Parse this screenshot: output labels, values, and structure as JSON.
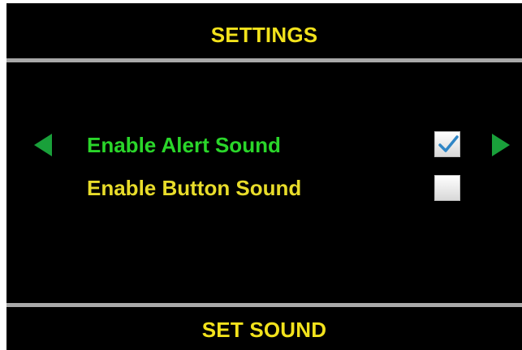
{
  "header": {
    "title": "SETTINGS"
  },
  "options": [
    {
      "label": "Enable Alert Sound",
      "checked": true,
      "selected": true,
      "color": "#2ad62a"
    },
    {
      "label": "Enable Button Sound",
      "checked": false,
      "selected": false,
      "color": "#e8dc2a"
    }
  ],
  "navigation": {
    "prev_icon": "arrow-left-icon",
    "next_icon": "arrow-right-icon",
    "accent_color": "#19a03a"
  },
  "footer": {
    "title": "SET SOUND"
  },
  "colors": {
    "background": "#000000",
    "title": "#f2e21c",
    "divider": "#a9a9a9"
  }
}
